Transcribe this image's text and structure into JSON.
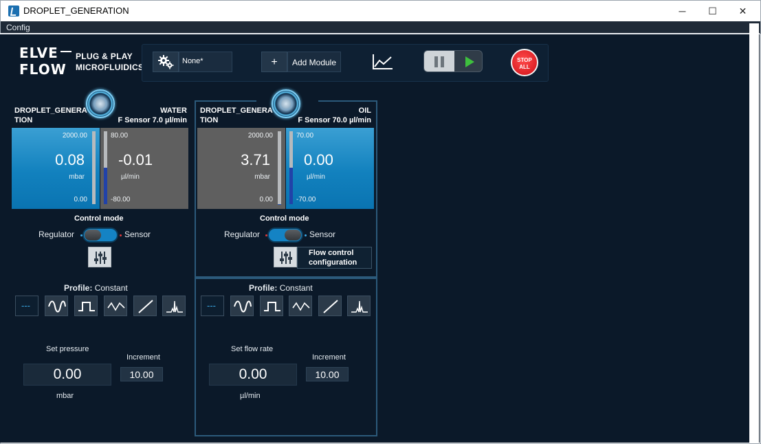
{
  "window": {
    "title": "DROPLET_GENERATION",
    "minimize": "─",
    "maximize": "☐",
    "close": "✕"
  },
  "menu": {
    "config": "Config"
  },
  "header": {
    "logo_line1": "ELVE",
    "logo_line2": "FLOW",
    "tagline1": "PLUG & PLAY",
    "tagline2": "MICROFLUIDICS",
    "config_value": "None*",
    "add_module_plus": "+",
    "add_module": "Add Module",
    "stop_all_1": "STOP",
    "stop_all_2": "ALL"
  },
  "modules": [
    {
      "name_line1": "DROPLET_GENERA",
      "name_line2": "TION",
      "fluid": "WATER",
      "sensor": "F Sensor 7.0 µl/min",
      "pressure": {
        "max": "2000.00",
        "value": "0.08",
        "unit": "mbar",
        "min": "0.00",
        "level": 0.0
      },
      "flow": {
        "max": "80.00",
        "value": "-0.01",
        "unit": "µl/min",
        "min": "-80.00",
        "level": 0.0
      },
      "control_mode": "Control mode",
      "regulator": "Regulator",
      "sensor_label": "Sensor",
      "mode": "Regulator",
      "profile_label": "Profile:",
      "profile_value": "Constant",
      "dash_glyph": "---",
      "set_label": "Set pressure",
      "set_value": "0.00",
      "set_unit": "mbar",
      "increment_label": "Increment",
      "increment_value": "10.00"
    },
    {
      "name_line1": "DROPLET_GENERA",
      "name_line2": "TION",
      "fluid": "OIL",
      "sensor": "F Sensor 70.0 µl/min",
      "pressure": {
        "max": "2000.00",
        "value": "3.71",
        "unit": "mbar",
        "min": "0.00",
        "level": 0.002
      },
      "flow": {
        "max": "70.00",
        "value": "0.00",
        "unit": "µl/min",
        "min": "-70.00",
        "level": 0.0
      },
      "control_mode": "Control mode",
      "regulator": "Regulator",
      "sensor_label": "Sensor",
      "mode": "Sensor",
      "flow_config_1": "Flow control",
      "flow_config_2": "configuration",
      "profile_label": "Profile:",
      "profile_value": "Constant",
      "dash_glyph": "---",
      "set_label": "Set flow rate",
      "set_value": "0.00",
      "set_unit": "µl/min",
      "increment_label": "Increment",
      "increment_value": "10.00"
    }
  ],
  "profile_icons": [
    "dash-icon",
    "sine-icon",
    "square-wave-icon",
    "triangle-wave-icon",
    "ramp-icon",
    "spike-icon"
  ],
  "colors": {
    "background": "#0b1929",
    "display_blue": "#1281be",
    "display_gray": "#5f5f5f",
    "stop_red": "#d01018",
    "play_green": "#3ec03e"
  }
}
